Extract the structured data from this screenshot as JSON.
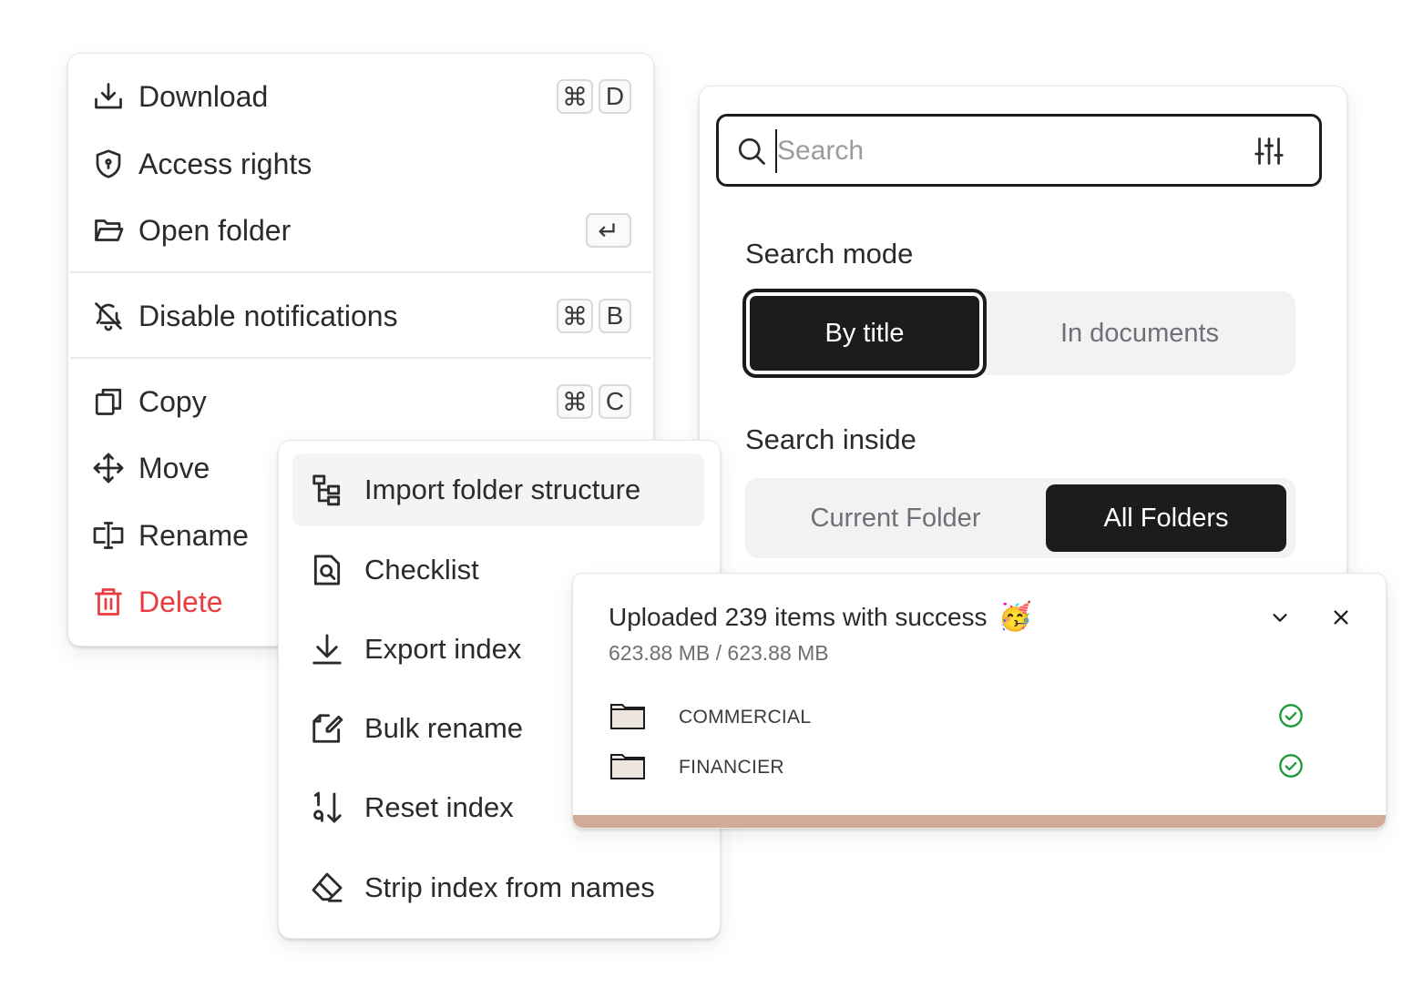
{
  "context_menu": {
    "items": [
      {
        "icon": "download-icon",
        "label": "Download",
        "keys": [
          "⌘",
          "D"
        ]
      },
      {
        "icon": "shield-icon",
        "label": "Access rights",
        "keys": []
      },
      {
        "icon": "folder-open-icon",
        "label": "Open folder",
        "keys": [
          "↵"
        ]
      },
      {
        "icon": "bell-off-icon",
        "label": "Disable notifications",
        "keys": [
          "⌘",
          "B"
        ]
      },
      {
        "icon": "copy-icon",
        "label": "Copy",
        "keys": [
          "⌘",
          "C"
        ]
      },
      {
        "icon": "move-icon",
        "label": "Move",
        "keys": []
      },
      {
        "icon": "rename-icon",
        "label": "Rename",
        "keys": []
      },
      {
        "icon": "trash-icon",
        "label": "Delete",
        "keys": []
      }
    ]
  },
  "submenu": {
    "items": [
      {
        "icon": "folder-tree-icon",
        "label": "Import folder structure"
      },
      {
        "icon": "checklist-icon",
        "label": "Checklist"
      },
      {
        "icon": "export-icon",
        "label": "Export index"
      },
      {
        "icon": "bulk-rename-icon",
        "label": "Bulk rename"
      },
      {
        "icon": "reset-index-icon",
        "label": "Reset index"
      },
      {
        "icon": "eraser-icon",
        "label": "Strip index from names"
      }
    ]
  },
  "search": {
    "placeholder": "Search",
    "value": "",
    "mode_title": "Search mode",
    "mode_options": [
      "By title",
      "In documents"
    ],
    "mode_selected": "By title",
    "inside_title": "Search inside",
    "inside_options": [
      "Current Folder",
      "All Folders"
    ],
    "inside_selected": "All Folders"
  },
  "upload": {
    "title": "Uploaded 239 items with success",
    "emoji": "🥳",
    "size": "623.88 MB / 623.88 MB",
    "progress": 1.0,
    "files": [
      {
        "name": "COMMERCIAL",
        "status": "done"
      },
      {
        "name": "FINANCIER",
        "status": "done"
      }
    ]
  },
  "colors": {
    "danger": "#ec3b3f",
    "dark": "#1c1c1e",
    "success": "#1e9a3b",
    "progress": "#d2ab97"
  }
}
